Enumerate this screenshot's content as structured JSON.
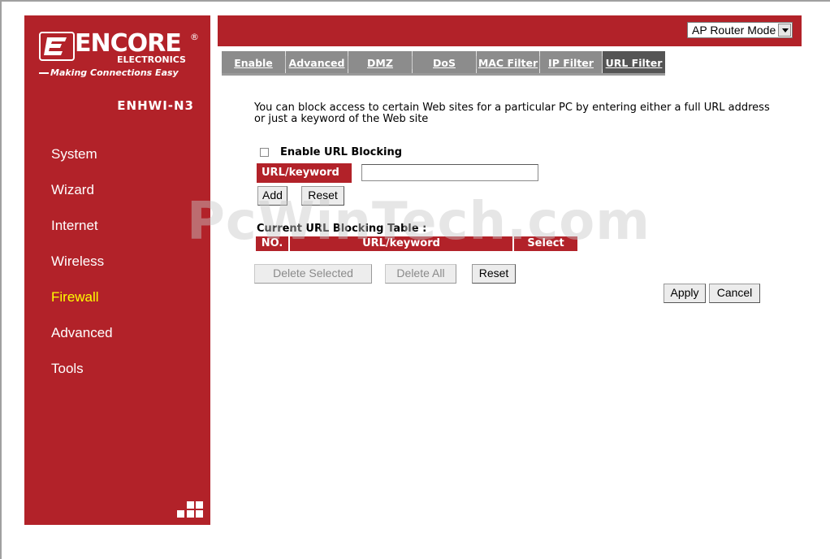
{
  "brand": {
    "logo_word": "ENCORE",
    "logo_sub": "ELECTRONICS",
    "tagline": "Making Connections Easy",
    "registered": "®",
    "model": "ENHWI-N3"
  },
  "sidebar": {
    "items": [
      {
        "label": "System",
        "active": false
      },
      {
        "label": "Wizard",
        "active": false
      },
      {
        "label": "Internet",
        "active": false
      },
      {
        "label": "Wireless",
        "active": false
      },
      {
        "label": "Firewall",
        "active": true
      },
      {
        "label": "Advanced",
        "active": false
      },
      {
        "label": "Tools",
        "active": false
      }
    ],
    "grid_icon": "grid-icon"
  },
  "header": {
    "mode_select_value": "AP Router Mode"
  },
  "tabs": [
    {
      "label": "Enable",
      "active": false
    },
    {
      "label": "Advanced",
      "active": false
    },
    {
      "label": "DMZ",
      "active": false
    },
    {
      "label": "DoS",
      "active": false
    },
    {
      "label": "MAC Filter",
      "active": false
    },
    {
      "label": "IP Filter",
      "active": false
    },
    {
      "label": "URL Filter",
      "active": true
    }
  ],
  "main": {
    "description": "You can block access to certain Web sites for a particular PC by entering either a full URL address or just a keyword of the Web site",
    "enable_label": "Enable URL Blocking",
    "enable_checked": false,
    "url_label": "URL/keyword",
    "url_value": "",
    "add_label": "Add",
    "reset_label": "Reset",
    "table_title": "Current URL Blocking Table :",
    "table_headers": [
      "NO.",
      "URL/keyword",
      "Select"
    ],
    "delete_selected_label": "Delete Selected",
    "delete_all_label": "Delete All",
    "reset2_label": "Reset",
    "apply_label": "Apply",
    "cancel_label": "Cancel"
  },
  "watermark": "PcWinTech.com",
  "colors": {
    "brand_red": "#b22229",
    "active_nav": "#ffff00",
    "tab_bg": "#8c8c8c",
    "tab_active_bg": "#555555"
  }
}
